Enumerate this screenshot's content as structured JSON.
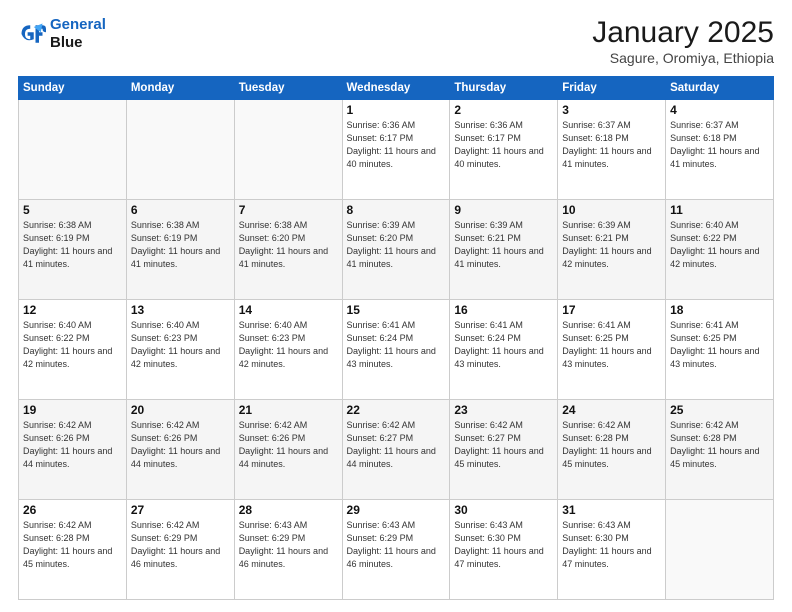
{
  "header": {
    "logo_line1": "General",
    "logo_line2": "Blue",
    "month_title": "January 2025",
    "subtitle": "Sagure, Oromiya, Ethiopia"
  },
  "days_of_week": [
    "Sunday",
    "Monday",
    "Tuesday",
    "Wednesday",
    "Thursday",
    "Friday",
    "Saturday"
  ],
  "weeks": [
    [
      {
        "day": "",
        "text": ""
      },
      {
        "day": "",
        "text": ""
      },
      {
        "day": "",
        "text": ""
      },
      {
        "day": "1",
        "text": "Sunrise: 6:36 AM\nSunset: 6:17 PM\nDaylight: 11 hours and 40 minutes."
      },
      {
        "day": "2",
        "text": "Sunrise: 6:36 AM\nSunset: 6:17 PM\nDaylight: 11 hours and 40 minutes."
      },
      {
        "day": "3",
        "text": "Sunrise: 6:37 AM\nSunset: 6:18 PM\nDaylight: 11 hours and 41 minutes."
      },
      {
        "day": "4",
        "text": "Sunrise: 6:37 AM\nSunset: 6:18 PM\nDaylight: 11 hours and 41 minutes."
      }
    ],
    [
      {
        "day": "5",
        "text": "Sunrise: 6:38 AM\nSunset: 6:19 PM\nDaylight: 11 hours and 41 minutes."
      },
      {
        "day": "6",
        "text": "Sunrise: 6:38 AM\nSunset: 6:19 PM\nDaylight: 11 hours and 41 minutes."
      },
      {
        "day": "7",
        "text": "Sunrise: 6:38 AM\nSunset: 6:20 PM\nDaylight: 11 hours and 41 minutes."
      },
      {
        "day": "8",
        "text": "Sunrise: 6:39 AM\nSunset: 6:20 PM\nDaylight: 11 hours and 41 minutes."
      },
      {
        "day": "9",
        "text": "Sunrise: 6:39 AM\nSunset: 6:21 PM\nDaylight: 11 hours and 41 minutes."
      },
      {
        "day": "10",
        "text": "Sunrise: 6:39 AM\nSunset: 6:21 PM\nDaylight: 11 hours and 42 minutes."
      },
      {
        "day": "11",
        "text": "Sunrise: 6:40 AM\nSunset: 6:22 PM\nDaylight: 11 hours and 42 minutes."
      }
    ],
    [
      {
        "day": "12",
        "text": "Sunrise: 6:40 AM\nSunset: 6:22 PM\nDaylight: 11 hours and 42 minutes."
      },
      {
        "day": "13",
        "text": "Sunrise: 6:40 AM\nSunset: 6:23 PM\nDaylight: 11 hours and 42 minutes."
      },
      {
        "day": "14",
        "text": "Sunrise: 6:40 AM\nSunset: 6:23 PM\nDaylight: 11 hours and 42 minutes."
      },
      {
        "day": "15",
        "text": "Sunrise: 6:41 AM\nSunset: 6:24 PM\nDaylight: 11 hours and 43 minutes."
      },
      {
        "day": "16",
        "text": "Sunrise: 6:41 AM\nSunset: 6:24 PM\nDaylight: 11 hours and 43 minutes."
      },
      {
        "day": "17",
        "text": "Sunrise: 6:41 AM\nSunset: 6:25 PM\nDaylight: 11 hours and 43 minutes."
      },
      {
        "day": "18",
        "text": "Sunrise: 6:41 AM\nSunset: 6:25 PM\nDaylight: 11 hours and 43 minutes."
      }
    ],
    [
      {
        "day": "19",
        "text": "Sunrise: 6:42 AM\nSunset: 6:26 PM\nDaylight: 11 hours and 44 minutes."
      },
      {
        "day": "20",
        "text": "Sunrise: 6:42 AM\nSunset: 6:26 PM\nDaylight: 11 hours and 44 minutes."
      },
      {
        "day": "21",
        "text": "Sunrise: 6:42 AM\nSunset: 6:26 PM\nDaylight: 11 hours and 44 minutes."
      },
      {
        "day": "22",
        "text": "Sunrise: 6:42 AM\nSunset: 6:27 PM\nDaylight: 11 hours and 44 minutes."
      },
      {
        "day": "23",
        "text": "Sunrise: 6:42 AM\nSunset: 6:27 PM\nDaylight: 11 hours and 45 minutes."
      },
      {
        "day": "24",
        "text": "Sunrise: 6:42 AM\nSunset: 6:28 PM\nDaylight: 11 hours and 45 minutes."
      },
      {
        "day": "25",
        "text": "Sunrise: 6:42 AM\nSunset: 6:28 PM\nDaylight: 11 hours and 45 minutes."
      }
    ],
    [
      {
        "day": "26",
        "text": "Sunrise: 6:42 AM\nSunset: 6:28 PM\nDaylight: 11 hours and 45 minutes."
      },
      {
        "day": "27",
        "text": "Sunrise: 6:42 AM\nSunset: 6:29 PM\nDaylight: 11 hours and 46 minutes."
      },
      {
        "day": "28",
        "text": "Sunrise: 6:43 AM\nSunset: 6:29 PM\nDaylight: 11 hours and 46 minutes."
      },
      {
        "day": "29",
        "text": "Sunrise: 6:43 AM\nSunset: 6:29 PM\nDaylight: 11 hours and 46 minutes."
      },
      {
        "day": "30",
        "text": "Sunrise: 6:43 AM\nSunset: 6:30 PM\nDaylight: 11 hours and 47 minutes."
      },
      {
        "day": "31",
        "text": "Sunrise: 6:43 AM\nSunset: 6:30 PM\nDaylight: 11 hours and 47 minutes."
      },
      {
        "day": "",
        "text": ""
      }
    ]
  ]
}
